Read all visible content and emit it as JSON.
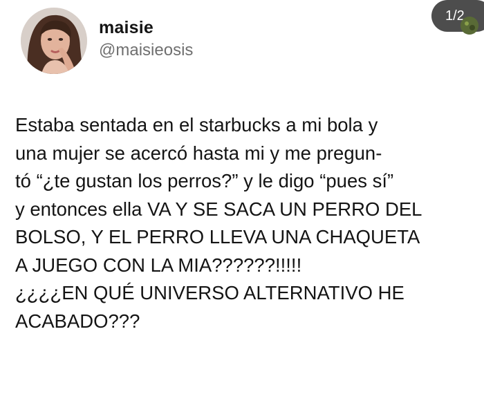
{
  "profile": {
    "display_name": "maisie",
    "handle": "@maisieosis",
    "avatar_icon": "profile-photo"
  },
  "pager": {
    "label": "1/2"
  },
  "tweet": {
    "lines": [
      "Estaba sentada en el starbucks a mi bola y",
      "una mujer se acercó hasta mi y me pregun-",
      "tó “¿te gustan los perros?” y le digo “pues sí”",
      "y entonces ella VA Y SE SACA UN PERRO DEL",
      "BOLSO, Y EL PERRO LLEVA UNA CHAQUETA",
      "A JUEGO CON LA MIA??????!!!!!",
      "¿¿¿¿EN QUÉ UNIVERSO ALTERNATIVO HE",
      "ACABADO???"
    ]
  },
  "colors": {
    "text": "#141414",
    "handle": "#6f6f6f",
    "pager_background": "#4d4d4d",
    "pager_text": "#ffffff",
    "background": "#ffffff"
  }
}
